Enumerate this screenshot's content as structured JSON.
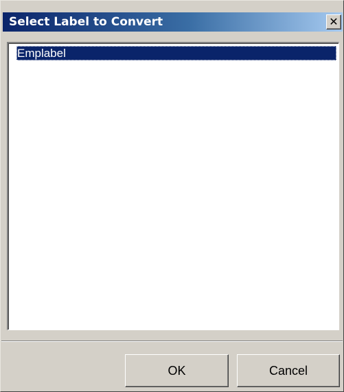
{
  "window": {
    "title": "Select Label to Convert",
    "close_glyph": "✕"
  },
  "list": {
    "items": [
      {
        "label": "Emplabel",
        "selected": true
      }
    ]
  },
  "buttons": {
    "ok_label": "OK",
    "cancel_label": "Cancel"
  },
  "colors": {
    "titlebar_start": "#0a246a",
    "titlebar_end": "#a6caf0",
    "selection": "#0a246a",
    "face": "#d4d0c8"
  }
}
